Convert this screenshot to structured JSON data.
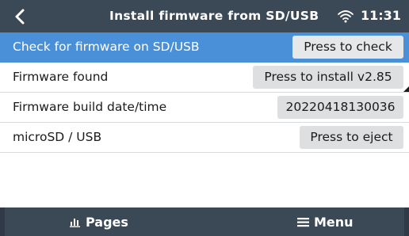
{
  "header": {
    "title": "Install firmware from SD/USB",
    "time": "11:31",
    "back_icon": "chevron-left-icon",
    "status_icon": "wifi-icon"
  },
  "rows": [
    {
      "label": "Check for firmware on SD/USB",
      "button": "Press to check",
      "selected": true
    },
    {
      "label": "Firmware found",
      "button": "Press to install v2.85",
      "selected": false
    },
    {
      "label": "Firmware build date/time",
      "button": "20220418130036",
      "selected": false
    },
    {
      "label": "microSD / USB",
      "button": "Press to eject",
      "selected": false
    }
  ],
  "footer": {
    "pages_label": "Pages",
    "pages_icon": "bar-chart-icon",
    "menu_label": "Menu",
    "menu_icon": "hamburger-icon"
  },
  "colors": {
    "header_bg": "#3b4856",
    "selected_row": "#4a90d9",
    "button_bg": "#dedfe0"
  }
}
